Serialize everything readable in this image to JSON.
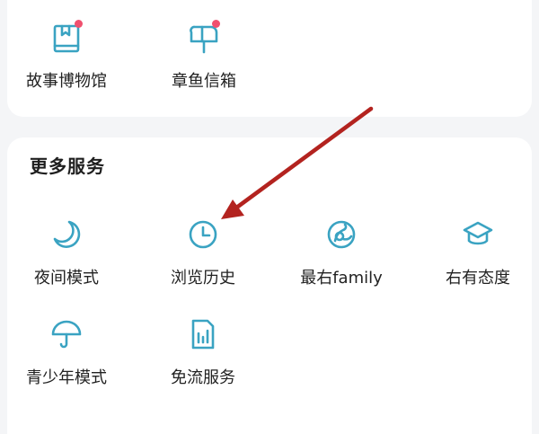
{
  "top_section": {
    "items": [
      {
        "label": "故事博物馆",
        "icon": "book-icon",
        "has_badge": true
      },
      {
        "label": "章鱼信箱",
        "icon": "mailbox-icon",
        "has_badge": true
      }
    ]
  },
  "more_services": {
    "title": "更多服务",
    "items": [
      {
        "label": "夜间模式",
        "icon": "moon-icon"
      },
      {
        "label": "浏览历史",
        "icon": "clock-icon"
      },
      {
        "label": "最右family",
        "icon": "family-icon"
      },
      {
        "label": "右有态度",
        "icon": "graduation-cap-icon"
      },
      {
        "label": "青少年模式",
        "icon": "umbrella-icon"
      },
      {
        "label": "免流服务",
        "icon": "sim-card-icon"
      }
    ]
  },
  "colors": {
    "icon_teal": "#3aa3c2",
    "badge_red": "#f0506e",
    "arrow_red": "#b3231f"
  }
}
